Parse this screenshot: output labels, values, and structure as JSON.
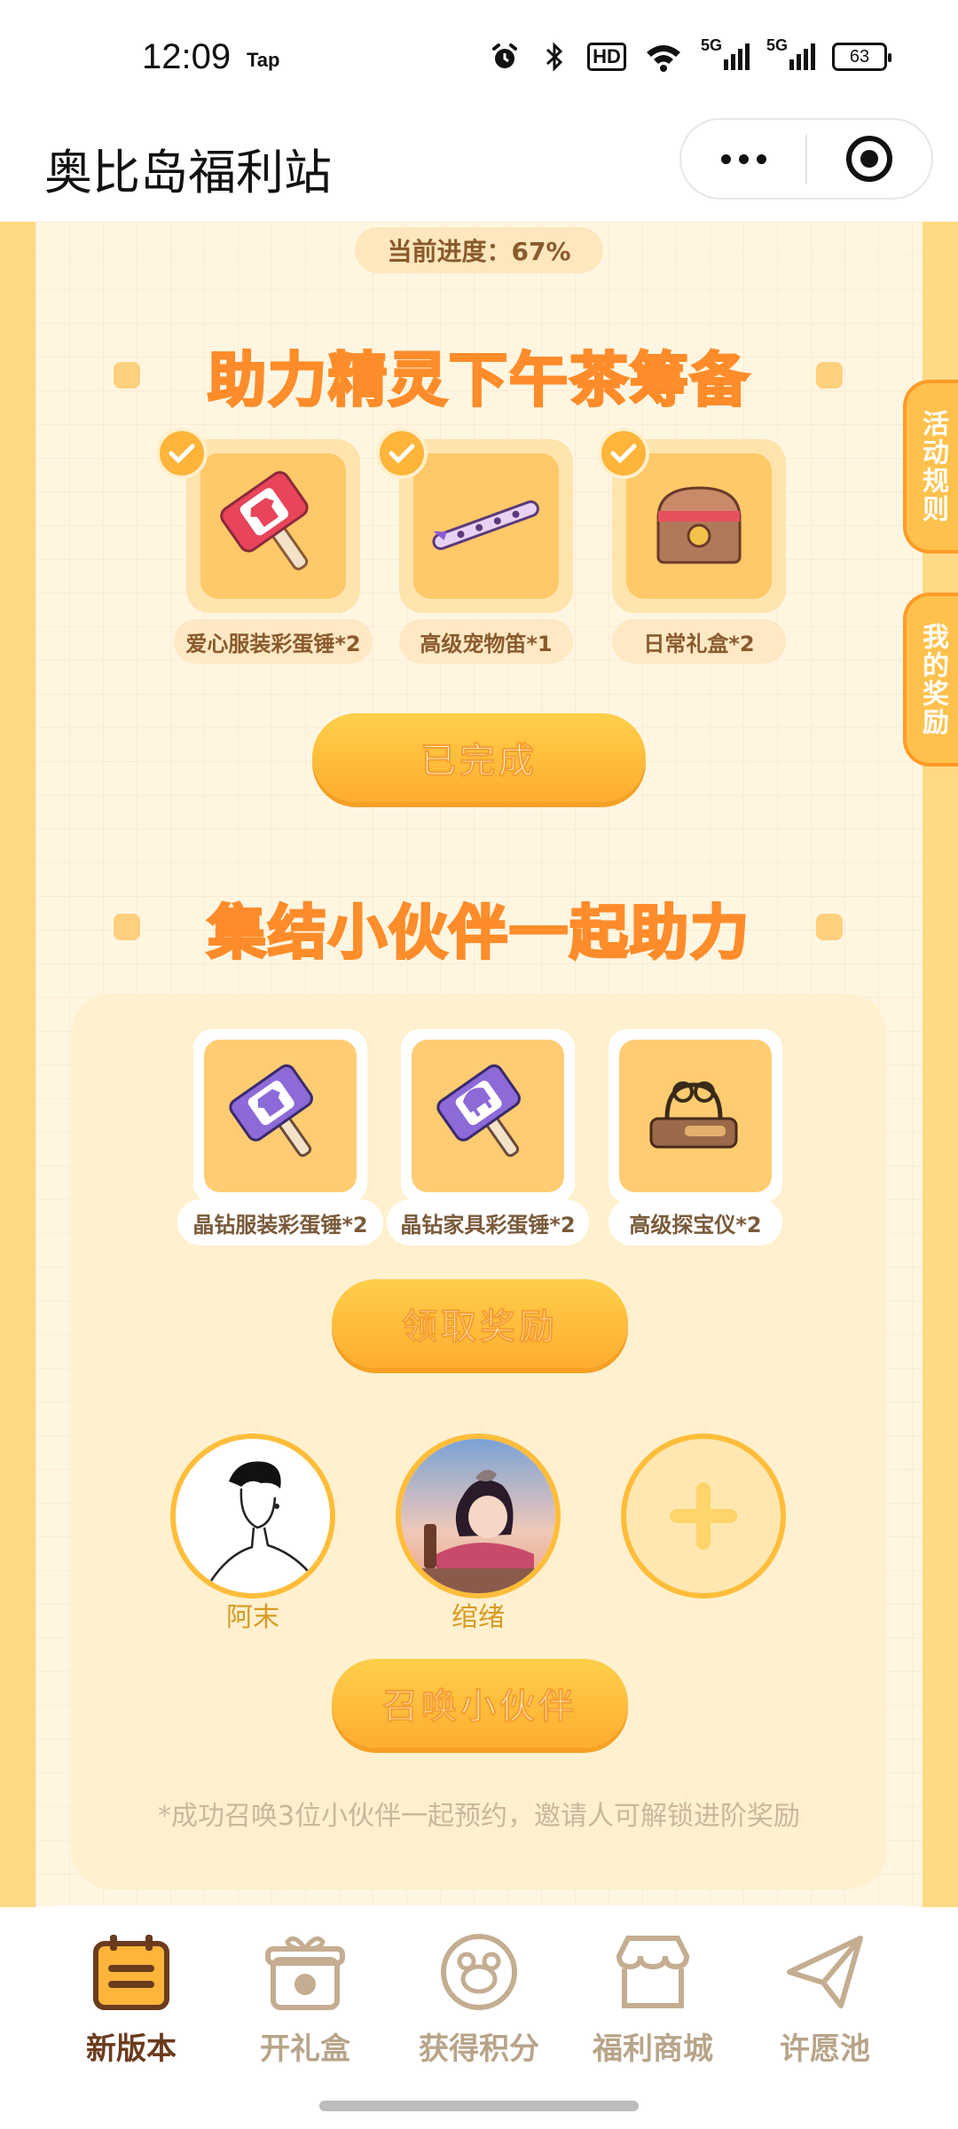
{
  "status_bar": {
    "time": "12:09",
    "tap": "Tap",
    "hd": "HD",
    "net1": "5G",
    "net2": "5G",
    "battery": "63"
  },
  "title_bar": {
    "title": "奥比岛福利站"
  },
  "progress": {
    "label": "当前进度：67%"
  },
  "section1": {
    "heading": "助力精灵下午茶筹备",
    "rewards": [
      {
        "label": "爱心服装彩蛋锤*2",
        "icon": "heart-clothes-hammer-icon",
        "checked": true
      },
      {
        "label": "高级宠物笛*1",
        "icon": "pet-flute-icon",
        "checked": true
      },
      {
        "label": "日常礼盒*2",
        "icon": "treasure-chest-icon",
        "checked": true
      }
    ],
    "button": "已完成"
  },
  "side_tabs": {
    "rules": "活动规则",
    "my_rewards": "我的奖励"
  },
  "section2": {
    "heading": "集结小伙伴一起助力",
    "rewards": [
      {
        "label": "晶钻服装彩蛋锤*2",
        "icon": "crystal-clothes-hammer-icon"
      },
      {
        "label": "晶钻家具彩蛋锤*2",
        "icon": "crystal-furniture-hammer-icon"
      },
      {
        "label": "高级探宝仪*2",
        "icon": "treasure-detector-icon"
      }
    ],
    "claim_button": "领取奖励",
    "partners": [
      {
        "name": "阿末",
        "avatar": "sketch-portrait"
      },
      {
        "name": "绾绪",
        "avatar": "girl-with-cat"
      }
    ],
    "summon_button": "召唤小伙伴",
    "note": "*成功召唤3位小伙伴一起预约，邀请人可解锁进阶奖励"
  },
  "bottom_nav": [
    {
      "label": "新版本",
      "icon": "calendar-icon",
      "active": true
    },
    {
      "label": "开礼盒",
      "icon": "gift-box-icon",
      "active": false
    },
    {
      "label": "获得积分",
      "icon": "points-bear-icon",
      "active": false
    },
    {
      "label": "福利商城",
      "icon": "shop-icon",
      "active": false
    },
    {
      "label": "许愿池",
      "icon": "paper-plane-icon",
      "active": false
    }
  ],
  "colors": {
    "accent": "#ffad2f",
    "heading_stroke": "#ff8c2a",
    "nav_active": "#6b3b1e",
    "nav_inactive": "#b8a489",
    "background": "#fff6e2"
  }
}
